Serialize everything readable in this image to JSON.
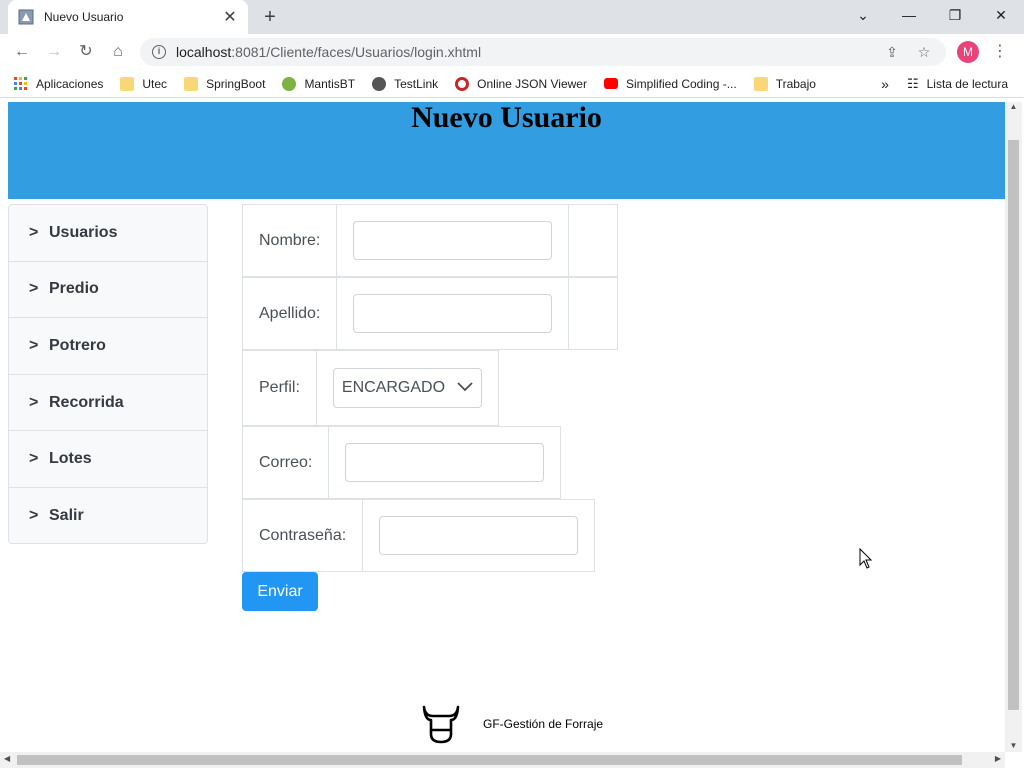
{
  "browser": {
    "tab_title": "Nuevo Usuario",
    "url_host": "localhost",
    "url_rest": ":8081/Cliente/faces/Usuarios/login.xhtml",
    "avatar_letter": "M",
    "bookmarks": [
      "Aplicaciones",
      "Utec",
      "SpringBoot",
      "MantisBT",
      "TestLink",
      "Online JSON Viewer",
      "Simplified Coding -...",
      "Trabajo"
    ],
    "reading_list": "Lista de lectura"
  },
  "header": {
    "title": "Nuevo Usuario"
  },
  "sidebar": {
    "items": [
      {
        "label": "Usuarios"
      },
      {
        "label": "Predio"
      },
      {
        "label": "Potrero"
      },
      {
        "label": "Recorrida"
      },
      {
        "label": "Lotes"
      },
      {
        "label": "Salir"
      }
    ]
  },
  "form": {
    "nombre_label": "Nombre:",
    "nombre_value": "",
    "apellido_label": "Apellido:",
    "apellido_value": "",
    "perfil_label": "Perfil:",
    "perfil_value": "ENCARGADO",
    "correo_label": "Correo:",
    "correo_value": "",
    "contrasena_label": "Contraseña:",
    "contrasena_value": "",
    "submit_label": "Enviar"
  },
  "footer": {
    "text": "GF-Gestión de Forraje"
  },
  "colors": {
    "header_bg": "#329de0",
    "button_bg": "#2196f3"
  }
}
